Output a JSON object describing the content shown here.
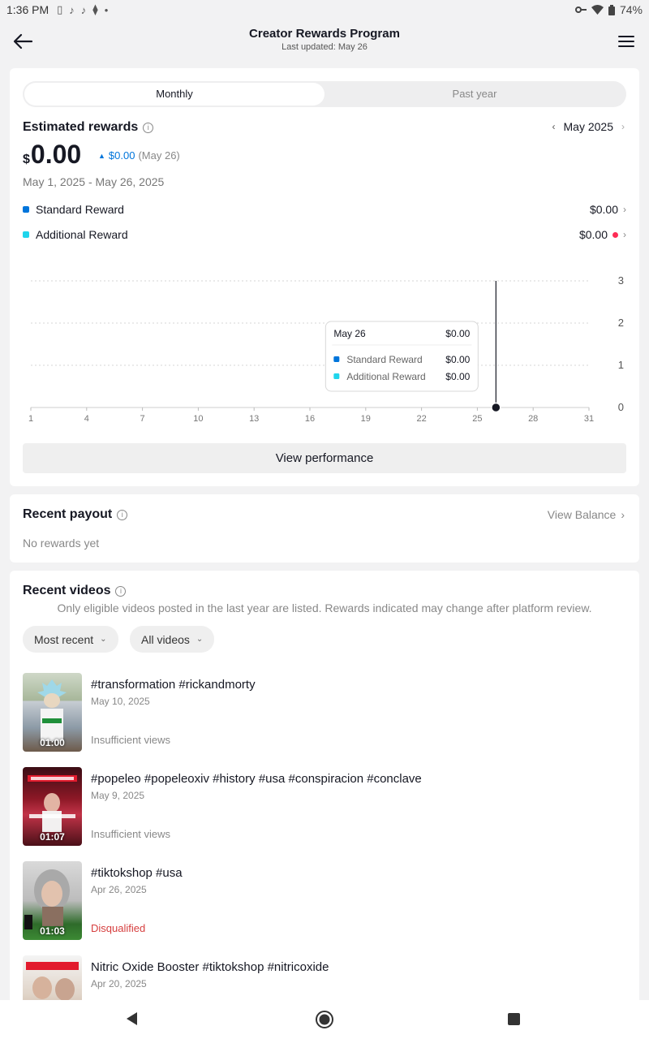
{
  "status_bar": {
    "time": "1:36 PM",
    "battery": "74%"
  },
  "header": {
    "title": "Creator Rewards Program",
    "subtitle": "Last updated: May 26"
  },
  "tabs": [
    {
      "label": "Monthly",
      "active": true
    },
    {
      "label": "Past year",
      "active": false
    }
  ],
  "rewards": {
    "title": "Estimated rewards",
    "month": "May 2025",
    "currency_symbol": "$",
    "amount": "0.00",
    "delta_value": "$0.00",
    "delta_date": "(May 26)",
    "date_range": "May 1, 2025 - May 26, 2025",
    "standard_label": "Standard Reward",
    "standard_value": "$0.00",
    "additional_label": "Additional Reward",
    "additional_value": "$0.00"
  },
  "chart_data": {
    "type": "line",
    "x": [
      1,
      4,
      7,
      10,
      13,
      16,
      19,
      22,
      25,
      28,
      31
    ],
    "xticks": [
      "1",
      "4",
      "7",
      "10",
      "13",
      "16",
      "19",
      "22",
      "25",
      "28",
      "31"
    ],
    "ylim": [
      0,
      3
    ],
    "yticks": [
      "0",
      "1",
      "2",
      "3"
    ],
    "series": [
      {
        "name": "Standard Reward",
        "color": "#0075db",
        "values": [
          0,
          0,
          0,
          0,
          0,
          0,
          0,
          0,
          0,
          0,
          0
        ]
      },
      {
        "name": "Additional Reward",
        "color": "#20d5ec",
        "values": [
          0,
          0,
          0,
          0,
          0,
          0,
          0,
          0,
          0,
          0,
          0
        ]
      }
    ],
    "selected_day": 26,
    "tooltip": {
      "date": "May 26",
      "total": "$0.00",
      "rows": [
        {
          "label": "Standard Reward",
          "value": "$0.00",
          "color": "#0075db"
        },
        {
          "label": "Additional Reward",
          "value": "$0.00",
          "color": "#20d5ec"
        }
      ]
    },
    "grid": true,
    "legend": "none"
  },
  "view_performance_label": "View performance",
  "payout": {
    "title": "Recent payout",
    "view_balance": "View Balance",
    "empty": "No rewards yet"
  },
  "videos": {
    "title": "Recent videos",
    "note": "Only eligible videos posted in the last year are listed. Rewards indicated may change after platform review.",
    "filter_sort": "Most recent",
    "filter_type": "All videos",
    "items": [
      {
        "caption": "#transformation #rickandmorty",
        "date": "May 10, 2025",
        "duration": "01:00",
        "status": "Insufficient views"
      },
      {
        "caption": "#popeleo #popeleoxiv #history #usa #conspiracion #conclave",
        "date": "May 9, 2025",
        "duration": "01:07",
        "status": "Insufficient views"
      },
      {
        "caption": "#tiktokshop #usa",
        "date": "Apr 26, 2025",
        "duration": "01:03",
        "status": "Disqualified"
      },
      {
        "caption": "Nitric Oxide Booster #tiktokshop #nitricoxide",
        "date": "Apr 20, 2025",
        "duration": "",
        "status": ""
      }
    ]
  },
  "colors": {
    "accent": "#0075db",
    "additional": "#20d5ec",
    "alert": "#fe2c55",
    "disqualified": "#d63e3e"
  }
}
